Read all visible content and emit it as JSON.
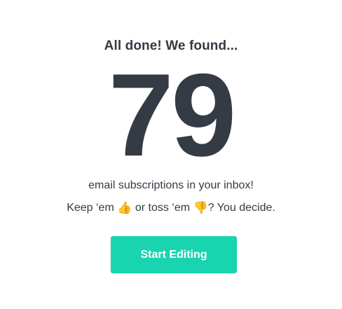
{
  "result": {
    "heading": "All done! We found...",
    "count": "79",
    "subscriptions_text": "email subscriptions in your inbox!",
    "decide": {
      "prefix": "Keep ‘em ",
      "thumbs_up_icon": "thumbs-up-icon",
      "thumbs_up_glyph": "👍",
      "middle": " or toss ‘em ",
      "thumbs_down_icon": "thumbs-down-icon",
      "thumbs_down_glyph": "👎",
      "suffix": "? You decide."
    }
  },
  "actions": {
    "start_editing_label": "Start Editing"
  },
  "colors": {
    "text": "#353b44",
    "accent": "#19d4b0",
    "button_text": "#ffffff",
    "background": "#ffffff"
  }
}
